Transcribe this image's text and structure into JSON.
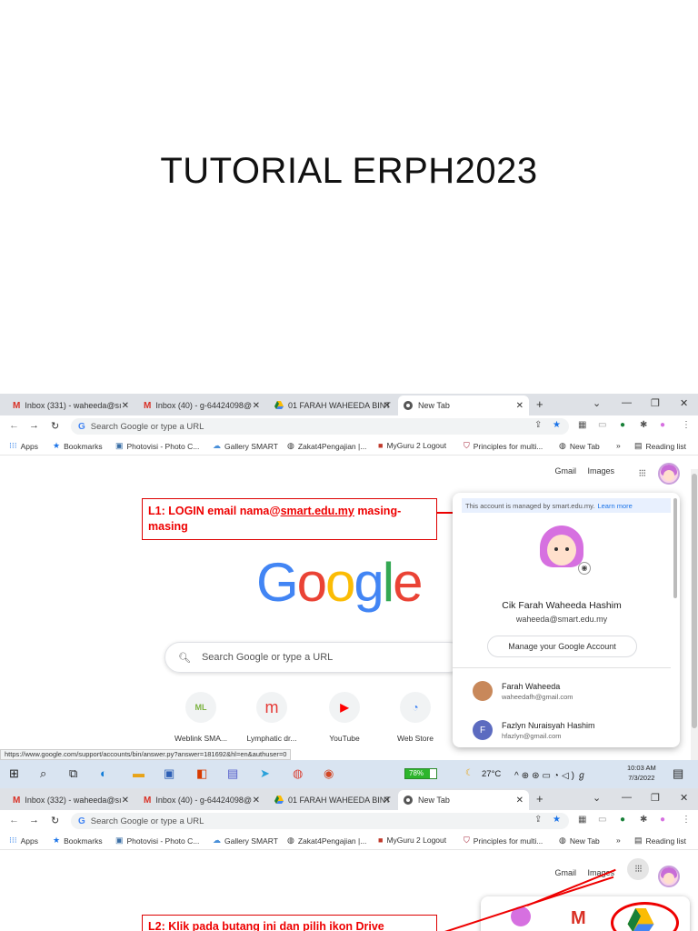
{
  "slide": {
    "title": "TUTORIAL ERPH2023"
  },
  "browser1": {
    "tabs": [
      {
        "icon": "gmail-icon",
        "label": "Inbox (331) - waheeda@sı"
      },
      {
        "icon": "gmail-icon",
        "label": "Inbox (40) - g-64424098@"
      },
      {
        "icon": "drive-icon",
        "label": "01 FARAH WAHEEDA BINTI"
      },
      {
        "icon": "chrome-icon",
        "label": "New Tab"
      }
    ],
    "omnibox_placeholder": "Search Google or type a URL",
    "bookmarks": [
      "Apps",
      "Bookmarks",
      "Photovisi - Photo C...",
      "Gallery SMART",
      "Zakat4Pengajian |...",
      "MyGuru 2 Logout",
      "Principles for multi...",
      "New Tab",
      "»",
      "Reading list"
    ],
    "top_links": {
      "gmail": "Gmail",
      "images": "Images"
    },
    "callout": {
      "prefix": "L1: LOGIN email nama@",
      "link": "smart.edu.my",
      "suffix": " masing-masing"
    },
    "search_placeholder": "Search Google or type a URL",
    "shortcuts": [
      {
        "abbr": "ML",
        "label": "Weblink SMA..."
      },
      {
        "abbr": "m",
        "label": "Lymphatic dr..."
      },
      {
        "abbr": "▶",
        "label": "YouTube"
      },
      {
        "abbr": "◔",
        "label": "Web Store"
      }
    ],
    "account_panel": {
      "managed_text": "This account is managed by smart.edu.my.",
      "learn_more": "Learn more",
      "name": "Cik Farah Waheeda Hashim",
      "email": "waheeda@smart.edu.my",
      "manage_button": "Manage your Google Account",
      "accounts": [
        {
          "initial": "",
          "name": "Farah Waheeda",
          "email": "waheedafh@gmail.com",
          "color": "#c8885a"
        },
        {
          "initial": "F",
          "name": "Fazlyn Nuraisyah Hashim",
          "email": "hfazlyn@gmail.com",
          "color": "#5c6bc0"
        }
      ]
    },
    "status_url": "https://www.google.com/support/accounts/bin/answer.py?answer=181692&hl=en&authuser=0",
    "taskbar": {
      "battery": "78%",
      "battery_level": 0.78,
      "temperature": "27°C",
      "time": "10:03 AM",
      "date": "7/3/2022"
    }
  },
  "browser2": {
    "tabs": [
      {
        "icon": "gmail-icon",
        "label": "Inbox (332) - waheeda@sı"
      },
      {
        "icon": "gmail-icon",
        "label": "Inbox (40) - g-64424098@"
      },
      {
        "icon": "drive-icon",
        "label": "01 FARAH WAHEEDA BINTI"
      },
      {
        "icon": "chrome-icon",
        "label": "New Tab"
      }
    ],
    "omnibox_placeholder": "Search Google or type a URL",
    "bookmarks": [
      "Apps",
      "Bookmarks",
      "Photovisi - Photo C...",
      "Gallery SMART",
      "Zakat4Pengajian |...",
      "MyGuru 2 Logout",
      "Principles for multi...",
      "New Tab",
      "»",
      "Reading list"
    ],
    "top_links": {
      "gmail": "Gmail",
      "images": "Images"
    },
    "callout": "L2: Klik pada butang ini dan pilih ikon Drive"
  }
}
